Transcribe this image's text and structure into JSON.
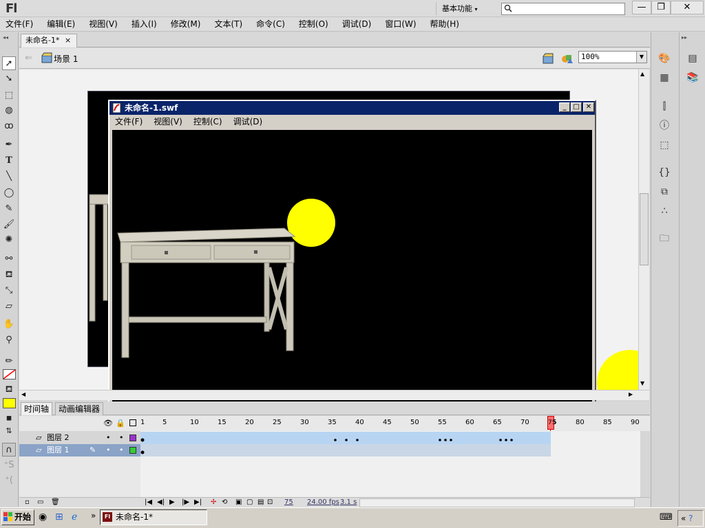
{
  "app": {
    "logo": "Fl",
    "workspace": "基本功能",
    "search_placeholder": ""
  },
  "window_buttons": {
    "minimize": "—",
    "restore": "❐",
    "close": "✕"
  },
  "menu": [
    "文件(F)",
    "编辑(E)",
    "视图(V)",
    "插入(I)",
    "修改(M)",
    "文本(T)",
    "命令(C)",
    "控制(O)",
    "调试(D)",
    "窗口(W)",
    "帮助(H)"
  ],
  "document": {
    "tab_label": "未命名-1*",
    "tab_close": "×"
  },
  "editbar": {
    "scene": "场景 1",
    "zoom": "100%"
  },
  "swf": {
    "title": "未命名-1.swf",
    "menu": [
      "文件(F)",
      "视图(V)",
      "控制(C)",
      "调试(D)"
    ],
    "circle_color": "#ffff00",
    "background": "#000000"
  },
  "timeline": {
    "tabs": {
      "timeline": "时间轴",
      "motion_editor": "动画编辑器"
    },
    "frame_numbers": [
      "1",
      "5",
      "10",
      "15",
      "20",
      "25",
      "30",
      "35",
      "40",
      "45",
      "50",
      "55",
      "60",
      "65",
      "70",
      "75",
      "80",
      "85",
      "90"
    ],
    "current_frame": 75,
    "layers": [
      {
        "name": "图层 2",
        "color": "#9933cc"
      },
      {
        "name": "图层 1",
        "color": "#33cc33"
      }
    ],
    "status": {
      "frame": "75",
      "fps": "24.00 fps",
      "time": "3.1 s"
    }
  },
  "taskbar": {
    "start": "开始",
    "task": "未命名-1*",
    "more": "»",
    "tray_arrow": "«"
  },
  "colors": {
    "fill": "#ffff00",
    "stroke": "#ff0000",
    "accent": "#0a246a"
  }
}
